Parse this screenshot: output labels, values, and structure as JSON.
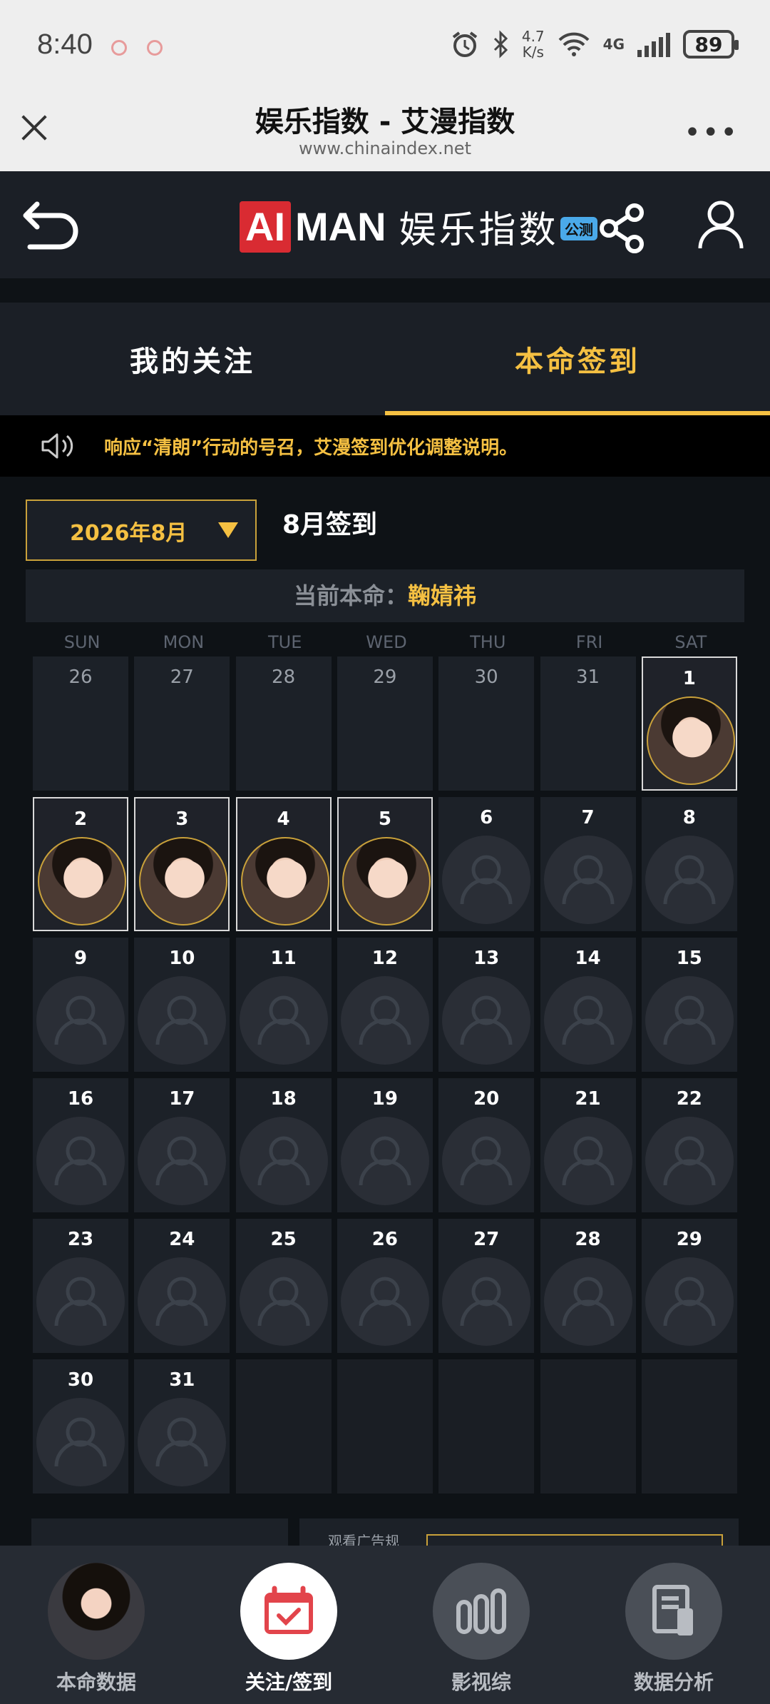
{
  "status": {
    "time": "8:40",
    "speed_value": "4.7",
    "speed_unit": "K/s",
    "network": "4G",
    "battery": "89"
  },
  "browser": {
    "title": "娱乐指数 - 艾漫指数",
    "url": "www.chinaindex.net"
  },
  "header": {
    "logo_ai": "AI",
    "logo_man": "MAN",
    "logo_cn": "娱乐指数",
    "beta": "公测"
  },
  "tabs": [
    {
      "label": "我的关注",
      "active": false
    },
    {
      "label": "本命签到",
      "active": true
    }
  ],
  "notice": {
    "text": "响应“清朗”行动的号召，艾漫签到优化调整说明。"
  },
  "calendar": {
    "month_select": "2026年8月",
    "month_title": "8月签到",
    "current_label": "当前本命：",
    "current_name": "鞠婧祎",
    "weekdays": [
      "SUN",
      "MON",
      "TUE",
      "WED",
      "THU",
      "FRI",
      "SAT"
    ],
    "cells": [
      {
        "d": "26",
        "s": "other"
      },
      {
        "d": "27",
        "s": "other"
      },
      {
        "d": "28",
        "s": "other"
      },
      {
        "d": "29",
        "s": "other"
      },
      {
        "d": "30",
        "s": "other"
      },
      {
        "d": "31",
        "s": "other"
      },
      {
        "d": "1",
        "s": "signed"
      },
      {
        "d": "2",
        "s": "signed"
      },
      {
        "d": "3",
        "s": "signed"
      },
      {
        "d": "4",
        "s": "signed"
      },
      {
        "d": "5",
        "s": "signed"
      },
      {
        "d": "6",
        "s": "empty"
      },
      {
        "d": "7",
        "s": "empty"
      },
      {
        "d": "8",
        "s": "empty"
      },
      {
        "d": "9",
        "s": "empty"
      },
      {
        "d": "10",
        "s": "empty"
      },
      {
        "d": "11",
        "s": "empty"
      },
      {
        "d": "12",
        "s": "empty"
      },
      {
        "d": "13",
        "s": "empty"
      },
      {
        "d": "14",
        "s": "empty"
      },
      {
        "d": "15",
        "s": "empty"
      },
      {
        "d": "16",
        "s": "empty"
      },
      {
        "d": "17",
        "s": "empty"
      },
      {
        "d": "18",
        "s": "empty"
      },
      {
        "d": "19",
        "s": "empty"
      },
      {
        "d": "20",
        "s": "empty"
      },
      {
        "d": "21",
        "s": "empty"
      },
      {
        "d": "22",
        "s": "empty"
      },
      {
        "d": "23",
        "s": "empty"
      },
      {
        "d": "24",
        "s": "empty"
      },
      {
        "d": "25",
        "s": "empty"
      },
      {
        "d": "26",
        "s": "empty"
      },
      {
        "d": "27",
        "s": "empty"
      },
      {
        "d": "28",
        "s": "empty"
      },
      {
        "d": "29",
        "s": "empty"
      },
      {
        "d": "30",
        "s": "empty"
      },
      {
        "d": "31",
        "s": "empty"
      },
      {
        "d": "",
        "s": "blank"
      },
      {
        "d": "",
        "s": "blank"
      },
      {
        "d": "",
        "s": "blank"
      },
      {
        "d": "",
        "s": "blank"
      },
      {
        "d": "",
        "s": "blank"
      }
    ]
  },
  "partial_panel": {
    "text": "观看广告规"
  },
  "bottom_nav": [
    {
      "label": "本命数据",
      "icon": "avatar-photo",
      "active": false
    },
    {
      "label": "关注/签到",
      "icon": "calendar-check-icon",
      "active": true
    },
    {
      "label": "影视综",
      "icon": "bars-icon",
      "active": false
    },
    {
      "label": "数据分析",
      "icon": "document-icon",
      "active": false
    }
  ],
  "colors": {
    "accent": "#f5c042",
    "brand_red": "#d92b32",
    "background": "#0e1216",
    "panel": "#1b1f26"
  }
}
